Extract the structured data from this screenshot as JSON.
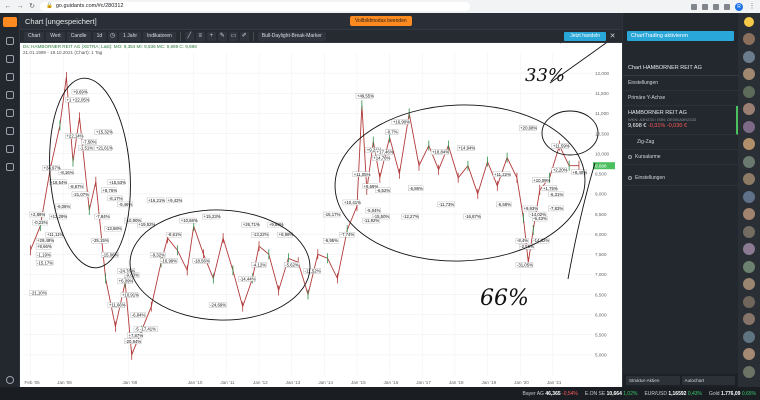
{
  "browser": {
    "url": "go.guidants.com/#c/280312",
    "profile_initial": "R"
  },
  "header": {
    "title": "Chart [ungespeichert]",
    "promo_button": "Vollbildmodus beenden"
  },
  "toolbar": {
    "chart_label": "Chart",
    "wert_label": "Wert",
    "candle_label": "Candle",
    "period_1d": "1d",
    "range_1y": "1 Jahr",
    "indicators_label": "Indikatoren",
    "marker_label": "Bull-Daylight-Break-Marker",
    "right_button": "Jetzt handeln"
  },
  "chart_info": {
    "line1": "Ds: HAMBORNER REIT AG (XETRA; Last): MO: 9,354 MI: 9,536 MC: 9,699 C: 9,698",
    "line2": "21.01.1999 - 19.10.2021 (Chart): 1 Tag"
  },
  "chart_data": {
    "type": "line",
    "title": "",
    "xlabel": "",
    "ylabel": "",
    "ylim": [
      4.5,
      12.5
    ],
    "y_ticks": [
      5.0,
      5.5,
      6.0,
      6.5,
      7.0,
      7.5,
      8.0,
      8.5,
      9.0,
      9.5,
      10.0,
      10.5,
      11.0,
      11.5,
      12.0
    ],
    "y_tick_labels": [
      "5,000",
      "5,500",
      "6,000",
      "6,500",
      "7,000",
      "7,500",
      "8,000",
      "8,500",
      "9,000",
      "9,500",
      "10,000",
      "10,500",
      "11,000",
      "11,500",
      "12,000"
    ],
    "x_ticks": [
      2005.0,
      2006.0,
      2008.0,
      2010.0,
      2011.0,
      2012.0,
      2013.0,
      2014.0,
      2015.0,
      2016.0,
      2017.0,
      2018.0,
      2019.0,
      2020.0,
      2021.0
    ],
    "x_tick_labels": [
      "Feb '05",
      "Jan '06",
      "Jan '08",
      "Jan '10",
      "Jan '11",
      "Jan '12",
      "Jan '13",
      "Jan '14",
      "Jan '15",
      "Jan '16",
      "Jan '17",
      "Jan '18",
      "Jan '19",
      "Jan '20",
      "Jan '21"
    ],
    "xlim": [
      2004.8,
      2022.2
    ],
    "series": [
      {
        "color": "#b23a3a",
        "x": [
          2005.0,
          2005.3,
          2005.6,
          2005.9,
          2006.1,
          2006.3,
          2006.5,
          2006.8,
          2007.0,
          2007.3,
          2007.6,
          2007.9,
          2008.1,
          2008.4,
          2008.7,
          2009.0,
          2009.2,
          2009.5,
          2009.8,
          2010.0,
          2010.3,
          2010.6,
          2010.9,
          2011.2,
          2011.5,
          2011.8,
          2012.0,
          2012.3,
          2012.6,
          2012.9,
          2013.2,
          2013.5,
          2013.8,
          2014.1,
          2014.4,
          2014.7,
          2015.0,
          2015.15,
          2015.3,
          2015.5,
          2015.7,
          2016.0,
          2016.3,
          2016.6,
          2016.9,
          2017.2,
          2017.5,
          2017.8,
          2018.1,
          2018.4,
          2018.7,
          2019.0,
          2019.3,
          2019.6,
          2019.9,
          2020.1,
          2020.25,
          2020.4,
          2020.6,
          2020.9,
          2021.2,
          2021.5,
          2021.8
        ],
        "y": [
          7.6,
          8.2,
          9.6,
          10.7,
          11.9,
          9.8,
          10.9,
          8.6,
          9.3,
          6.9,
          5.7,
          6.8,
          5.0,
          5.6,
          6.2,
          7.3,
          7.9,
          7.6,
          7.1,
          8.2,
          7.5,
          6.9,
          7.9,
          7.1,
          6.2,
          6.9,
          7.7,
          7.5,
          6.6,
          7.4,
          7.3,
          6.5,
          7.5,
          7.4,
          6.9,
          8.1,
          8.7,
          11.2,
          9.1,
          10.3,
          9.4,
          10.4,
          9.5,
          11.0,
          9.7,
          10.2,
          9.6,
          10.2,
          9.4,
          9.7,
          9.0,
          9.8,
          9.2,
          9.9,
          9.4,
          8.4,
          7.3,
          8.1,
          9.1,
          9.4,
          10.2,
          9.7,
          9.7
        ]
      }
    ],
    "last_value_label": "9,698",
    "annotations": [
      {
        "text": "+9,69%",
        "x": 2006.3,
        "y": 11.5
      },
      {
        "text": "+1 +22,05%",
        "x": 2006.1,
        "y": 11.3
      },
      {
        "text": "+15,32%",
        "x": 2007.0,
        "y": 10.5
      },
      {
        "text": "+22,14%",
        "x": 2006.1,
        "y": 10.4
      },
      {
        "text": "-7,50%",
        "x": 2006.6,
        "y": 10.25
      },
      {
        "text": "-1,51%",
        "x": 2006.5,
        "y": 10.1
      },
      {
        "text": "+21,61%",
        "x": 2007.0,
        "y": 10.1
      },
      {
        "text": "+34,97%",
        "x": 2005.4,
        "y": 9.6
      },
      {
        "text": "-8,16%",
        "x": 2005.9,
        "y": 9.5
      },
      {
        "text": "+18,54%",
        "x": 2005.6,
        "y": 9.25
      },
      {
        "text": "-8,67%",
        "x": 2006.2,
        "y": 9.15
      },
      {
        "text": "+15,53%",
        "x": 2007.4,
        "y": 9.25
      },
      {
        "text": "+8,76%",
        "x": 2007.2,
        "y": 9.05
      },
      {
        "text": "-21,07%",
        "x": 2006.3,
        "y": 8.95
      },
      {
        "text": "-8,17%",
        "x": 2007.4,
        "y": 8.85
      },
      {
        "text": "-9,46%",
        "x": 2007.7,
        "y": 8.7
      },
      {
        "text": "-6,06%",
        "x": 2005.8,
        "y": 8.65
      },
      {
        "text": "+16,21%",
        "x": 2008.6,
        "y": 8.8
      },
      {
        "text": "+9,42%",
        "x": 2009.2,
        "y": 8.8
      },
      {
        "text": "+2,89%",
        "x": 2005.0,
        "y": 8.45
      },
      {
        "text": "+13,29%",
        "x": 2005.6,
        "y": 8.4
      },
      {
        "text": "-7,84%",
        "x": 2007.0,
        "y": 8.4
      },
      {
        "text": "-10,90%",
        "x": 2007.9,
        "y": 8.3
      },
      {
        "text": "+19,52%",
        "x": 2008.3,
        "y": 8.2
      },
      {
        "text": "+15,23%",
        "x": 2010.3,
        "y": 8.4
      },
      {
        "text": "+10,68%",
        "x": 2009.6,
        "y": 8.3
      },
      {
        "text": "+26,71%",
        "x": 2011.5,
        "y": 8.2
      },
      {
        "text": "+9,69%",
        "x": 2012.3,
        "y": 8.2
      },
      {
        "text": "-15,17%",
        "x": 2014.0,
        "y": 8.45
      },
      {
        "text": "+10,41%",
        "x": 2014.6,
        "y": 8.75
      },
      {
        "text": "-0,23%",
        "x": 2005.1,
        "y": 8.25
      },
      {
        "text": "-13,68%",
        "x": 2007.3,
        "y": 8.1
      },
      {
        "text": "+11,11%",
        "x": 2005.5,
        "y": 7.95
      },
      {
        "text": "+29,48%",
        "x": 2005.2,
        "y": 7.8
      },
      {
        "text": "-25,15%",
        "x": 2006.9,
        "y": 7.8
      },
      {
        "text": "-8,61%",
        "x": 2009.2,
        "y": 7.95
      },
      {
        "text": "-13,22%",
        "x": 2011.8,
        "y": 7.95
      },
      {
        "text": "+8,98%",
        "x": 2012.6,
        "y": 7.95
      },
      {
        "text": "-7,74%",
        "x": 2014.5,
        "y": 7.95
      },
      {
        "text": "-6,95%",
        "x": 2014.0,
        "y": 7.8
      },
      {
        "text": "+9,66%",
        "x": 2005.2,
        "y": 7.65
      },
      {
        "text": "-15,06%",
        "x": 2007.2,
        "y": 7.45
      },
      {
        "text": "-9,32%",
        "x": 2008.7,
        "y": 7.45
      },
      {
        "text": "-16,99%",
        "x": 2009.0,
        "y": 7.3
      },
      {
        "text": "-18,56%",
        "x": 2010.0,
        "y": 7.3
      },
      {
        "text": "-4,12%",
        "x": 2011.8,
        "y": 7.2
      },
      {
        "text": "-5,62%",
        "x": 2012.8,
        "y": 7.2
      },
      {
        "text": "-11,52%",
        "x": 2013.4,
        "y": 7.05
      },
      {
        "text": "-14,44%",
        "x": 2011.4,
        "y": 6.85
      },
      {
        "text": "-1,19%",
        "x": 2005.2,
        "y": 7.45
      },
      {
        "text": "-15,17%",
        "x": 2005.2,
        "y": 7.25
      },
      {
        "text": "-24,76%",
        "x": 2007.7,
        "y": 7.05
      },
      {
        "text": "-9,83%",
        "x": 2007.9,
        "y": 6.95
      },
      {
        "text": "+6,09%",
        "x": 2007.7,
        "y": 6.8
      },
      {
        "text": "-24,69%",
        "x": 2010.5,
        "y": 6.2
      },
      {
        "text": "-21,10%",
        "x": 2005.0,
        "y": 6.5
      },
      {
        "text": "+10,91%",
        "x": 2007.8,
        "y": 6.45
      },
      {
        "text": "+11,66%",
        "x": 2007.4,
        "y": 6.2
      },
      {
        "text": "-6,84%",
        "x": 2008.1,
        "y": 5.95
      },
      {
        "text": "-5 -17,41%",
        "x": 2008.2,
        "y": 5.6
      },
      {
        "text": "+7,87%",
        "x": 2008.0,
        "y": 5.45
      },
      {
        "text": "-20,94%",
        "x": 2007.9,
        "y": 5.3
      },
      {
        "text": "+49,55%",
        "x": 2015.0,
        "y": 11.4
      },
      {
        "text": "+16,90%",
        "x": 2016.1,
        "y": 10.75
      },
      {
        "text": "+20,68%",
        "x": 2020.0,
        "y": 10.6
      },
      {
        "text": "-0,7%",
        "x": 2015.9,
        "y": 10.5
      },
      {
        "text": "+9,21%",
        "x": 2015.3,
        "y": 10.05
      },
      {
        "text": "+17,46%",
        "x": 2015.6,
        "y": 10.0
      },
      {
        "text": "+18,84%",
        "x": 2017.3,
        "y": 10.0
      },
      {
        "text": "+14,94%",
        "x": 2018.1,
        "y": 10.1
      },
      {
        "text": "+11,59%",
        "x": 2021.0,
        "y": 10.15
      },
      {
        "text": "+14,76%",
        "x": 2015.5,
        "y": 9.85
      },
      {
        "text": "+11,22%",
        "x": 2019.2,
        "y": 9.45
      },
      {
        "text": "+11,05%",
        "x": 2014.9,
        "y": 9.45
      },
      {
        "text": "+2,20%",
        "x": 2021.0,
        "y": 9.55
      },
      {
        "text": "+8,40%",
        "x": 2021.6,
        "y": 9.5
      },
      {
        "text": "+10,09%",
        "x": 2020.4,
        "y": 9.3
      },
      {
        "text": "+8,69%",
        "x": 2015.2,
        "y": 9.15
      },
      {
        "text": "-6,52%",
        "x": 2015.6,
        "y": 9.05
      },
      {
        "text": "-6,86%",
        "x": 2016.6,
        "y": 9.1
      },
      {
        "text": "+1,75%",
        "x": 2020.7,
        "y": 9.1
      },
      {
        "text": "-6,31%",
        "x": 2020.9,
        "y": 8.95
      },
      {
        "text": "-11,73%",
        "x": 2017.5,
        "y": 8.7
      },
      {
        "text": "-5,58%",
        "x": 2019.3,
        "y": 8.7
      },
      {
        "text": "+9,93%",
        "x": 2020.1,
        "y": 8.6
      },
      {
        "text": "-7,83%",
        "x": 2020.9,
        "y": 8.6
      },
      {
        "text": "-5,04%",
        "x": 2015.3,
        "y": 8.55
      },
      {
        "text": "-15,50%",
        "x": 2015.5,
        "y": 8.4
      },
      {
        "text": "-11,92%",
        "x": 2015.2,
        "y": 8.3
      },
      {
        "text": "-12,27%",
        "x": 2016.4,
        "y": 8.4
      },
      {
        "text": "-16,87%",
        "x": 2018.3,
        "y": 8.4
      },
      {
        "text": "-6,43%",
        "x": 2020.4,
        "y": 8.35
      },
      {
        "text": "-14,02%",
        "x": 2020.3,
        "y": 8.45
      },
      {
        "text": "-8,4%",
        "x": 2019.9,
        "y": 7.8
      },
      {
        "text": "-14,82%",
        "x": 2020.4,
        "y": 7.8
      },
      {
        "text": "-2,58%",
        "x": 2020.0,
        "y": 7.65
      },
      {
        "text": "-31,05%",
        "x": 2019.9,
        "y": 7.2
      }
    ]
  },
  "panel": {
    "cta": "ChartTrading aktivieren",
    "heading": "Chart HAMBORNER REIT AG",
    "item_settings": "Einstellungen",
    "item_primary_axis": "Primäre Y-Achse",
    "asset_name": "HAMBORNER REIT AG",
    "asset_wkn": "WKN: A3H233 / ISIN: DE000A3H2333",
    "asset_price": "9,698 €",
    "asset_change": "-0,31% -0,030 €",
    "item_zigzag": "Zig-Zag",
    "item_alarm": "Kursalarme",
    "item_settings2": "Einstellungen",
    "bottom_left": "Struktur-Aktien",
    "bottom_right": "Autochart"
  },
  "status": {
    "t1_name": "Bayer AG",
    "t1_val": "46,365",
    "t1_chg": "-0,54%",
    "t2_name": "E.ON SE",
    "t2_val": "10,664",
    "t2_chg": "1,02%",
    "t3_name": "EUR/USD",
    "t3_val": "1,16592",
    "t3_chg": "0,43%",
    "t4_name": "Gold",
    "t4_val": "1.776,09",
    "t4_chg": "0,65%"
  },
  "colors": {
    "accent": "#ff8a1f",
    "cta_blue": "#2aa7d9",
    "price_label": "#4cbf5e",
    "series": "#b23a3a",
    "negative": "#ff5a5a",
    "positive": "#36c96b"
  },
  "handwritten": {
    "note_top": "33%",
    "note_bottom": "66%"
  }
}
